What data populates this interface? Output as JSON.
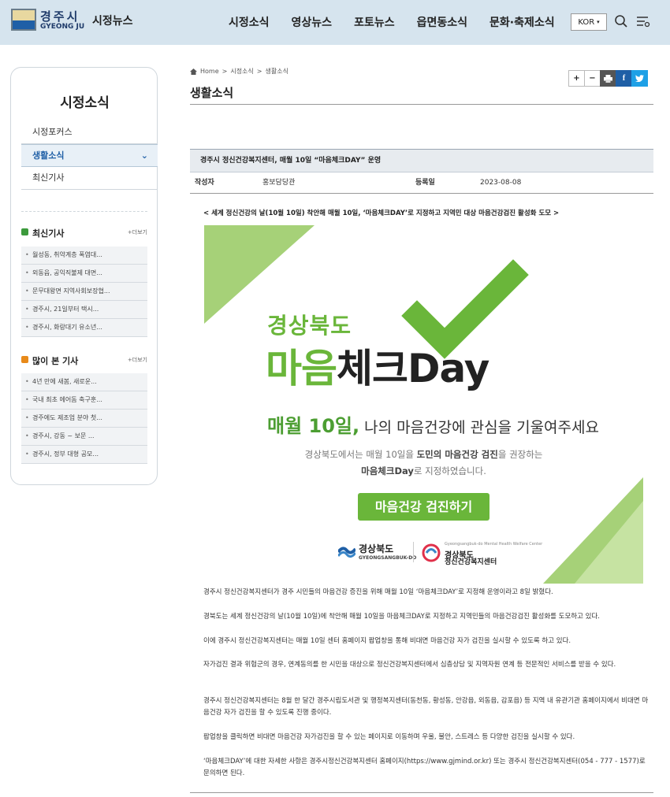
{
  "header": {
    "logo_city": "경주시",
    "logo_en": "GYEONG JU",
    "site_title": "시정뉴스",
    "nav": [
      "시정소식",
      "영상뉴스",
      "포토뉴스",
      "읍면동소식",
      "문화·축제소식"
    ],
    "lang": "KOR"
  },
  "sidebar": {
    "title": "시정소식",
    "menu": [
      "시정포커스",
      "생활소식",
      "최신기사"
    ],
    "latest": {
      "title": "최신기사",
      "more": "+더보기",
      "items": [
        "월성동, 취약계층 폭염대...",
        "외동읍, 공익직불제 대면...",
        "문무대왕면 지역사회보장협...",
        "경주시, 21일부터 택시...",
        "경주시, 화랑대기 유소년..."
      ]
    },
    "popular": {
      "title": "많이 본 기사",
      "more": "+더보기",
      "items": [
        "4년 만에 새봄, 새로운...",
        "국내 최초 에어돔 축구훈...",
        "경주에도 제조업 분야 첫...",
        "경주시, 강동 ~ 보문 ...",
        "경주시, 정부 대형 공모..."
      ]
    }
  },
  "breadcrumb": {
    "home": "Home",
    "level1": "시정소식",
    "level2": "생활소식"
  },
  "tools": {
    "plus": "+",
    "minus": "−",
    "facebook": "f"
  },
  "page_title": "생활소식",
  "article": {
    "title": "경주시 정신건강복지센터, 매월 10일 “마음체크DAY” 운영",
    "author_label": "작성자",
    "author": "홍보담당관",
    "date_label": "등록일",
    "date": "2023-08-08",
    "summary": "< 세계 정신건강의 날(10월 10일) 착안해 매월 10일, ‘마음체크DAY’로 지정하고 지역민 대상 마음건강검진 활성화 도모 >",
    "poster": {
      "region": "경상북도",
      "main_green": "마음",
      "main_dark": "체크Day",
      "day_highlight": "매월 10일,",
      "day_text": " 나의 마음건강에 관심을 기울여주세요",
      "desc1_a": "경상북도에서는 매월 10일을 ",
      "desc1_b": "도민의 마음건강 검진",
      "desc1_c": "을 권장하는",
      "desc2_a": "마음체크Day",
      "desc2_b": "로 지정하였습니다.",
      "button": "마음건강 검진하기",
      "logo1_name": "경상북도",
      "logo1_en": "GYEONGSANGBUK-DO",
      "logo2_sub": "Gyeongsangbuk-do Mental Health Welfare Center",
      "logo2_name": "경상북도",
      "logo2_name2": "정신건강복지센터"
    },
    "paragraphs": [
      "경주시 정신건강복지센터가 경주 시민들의 마음건강 증진을 위해 매월 10일 ‘마음체크DAY’로 지정해 운영이라고 8일 밝혔다.",
      "경북도는 세계 정신건강의 날(10월 10일)에 착안해 매월 10일을 마음체크DAY로 지정하고 지역민들의 마음건강검진 활성화를 도모하고 있다.",
      "이에 경주시 정신건강복지센터는 매월 10일 센터 홈페이지 팝업창을 통해 비대면 마음건강 자가 검진을 실시할 수 있도록 하고 있다.",
      "자가검진 결과 위험군의 경우, 연계동의를 한 시민을 대상으로 정신건강복지센터에서 심층상담 및 지역자원 연계 등 전문적인 서비스를 받을 수 있다.",
      "경주시 정신건강복지센터는 8월 한 달간 경주시립도서관 및 행정복지센터(동천동, 황성동, 안강읍, 외동읍, 감포읍) 등 지역 내 유관기관 홈페이지에서 비대면 마음건강 자가 검진을 할 수 있도록 진행 중이다.",
      "팝업창을 클릭하면 비대면 마음건강 자가검진을 할 수 있는 페이지로 이동하며 우울, 불안, 스트레스 등 다양한 검진을 실시할 수 있다.",
      "‘마음체크DAY’에 대한 자세한 사항은 경주시정신건강복지센터 홈페이지(https://www.gjmind.or.kr) 또는 경주시 정신건강복지센터(054 - 777 - 1577)로 문의하면 된다."
    ]
  },
  "colors": {
    "accent": "#1f5fa6",
    "poster_green": "#6ab63a",
    "header_bg": "#d6e4ee"
  },
  "icons": [
    "home-icon",
    "search-icon",
    "menu-icon",
    "print-icon",
    "facebook-icon",
    "twitter-icon",
    "chevron-down-icon",
    "check-icon"
  ]
}
